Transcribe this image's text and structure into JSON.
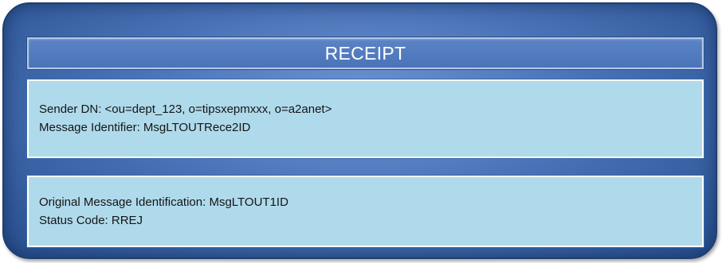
{
  "receipt": {
    "title": "RECEIPT",
    "sections": [
      {
        "lines": [
          "Sender DN: <ou=dept_123, o=tipsxepmxxx, o=a2anet>",
          "Message Identifier: MsgLTOUTRece2ID"
        ]
      },
      {
        "lines": [
          "Original Message Identification: MsgLTOUT1ID",
          "Status Code: RREJ"
        ]
      }
    ]
  }
}
